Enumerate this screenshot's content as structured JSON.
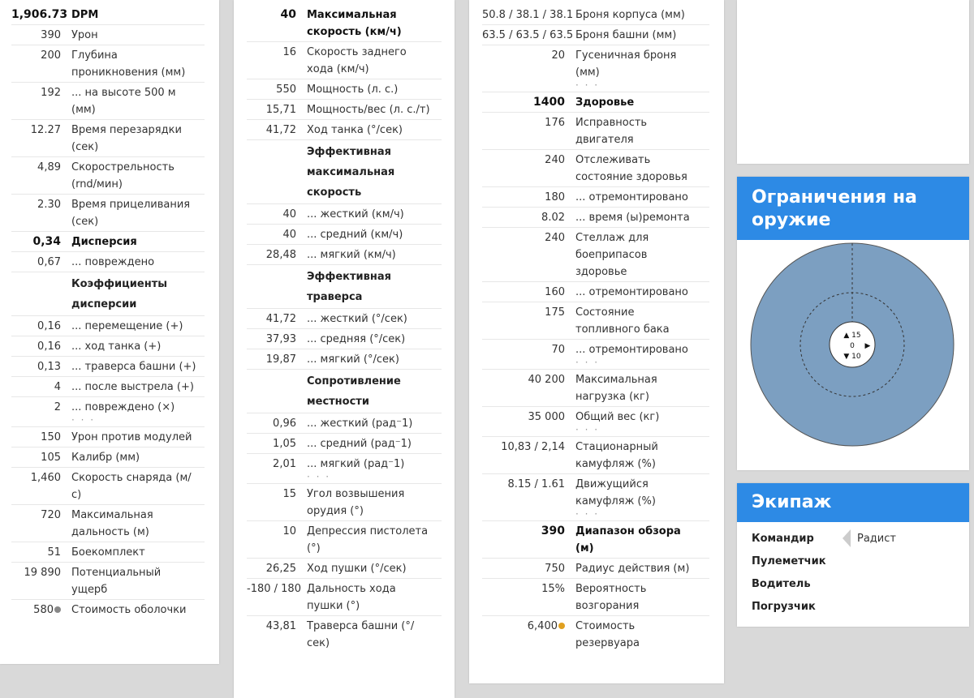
{
  "col1": [
    {
      "v": "1,906.73",
      "l": "DPM",
      "bold": true
    },
    {
      "v": "390",
      "l": "Урон"
    },
    {
      "v": "200",
      "l": "Глубина проникновения (мм)"
    },
    {
      "v": "192",
      "l": "... на высоте 500 м (мм)"
    },
    {
      "v": "12.27",
      "l": "Время перезарядки (сек)"
    },
    {
      "v": "4,89",
      "l": "Скорострельность (rnd/мин)"
    },
    {
      "v": "2.30",
      "l": "Время прицеливания (сек)"
    },
    {
      "v": "0,34",
      "l": "Дисперсия",
      "bold": true
    },
    {
      "v": "0,67",
      "l": "... повреждено"
    },
    {
      "v": "",
      "l": "Коэффициенты дисперсии",
      "heading": true
    },
    {
      "v": "0,16",
      "l": "... перемещение (+)"
    },
    {
      "v": "0,16",
      "l": "... ход танка (+)"
    },
    {
      "v": "0,13",
      "l": "... траверса башни (+)"
    },
    {
      "v": "4",
      "l": "... после выстрела (+)"
    },
    {
      "v": "2",
      "l": "... повреждено (×)",
      "dots": true
    },
    {
      "v": "150",
      "l": "Урон против модулей"
    },
    {
      "v": "105",
      "l": "Калибр (мм)"
    },
    {
      "v": "1,460",
      "l": "Скорость снаряда (м/с)"
    },
    {
      "v": "720",
      "l": "Максимальная дальность (м)"
    },
    {
      "v": "51",
      "l": "Боекомплект"
    },
    {
      "v": "19 890",
      "l": "Потенциальный ущерб"
    },
    {
      "v": "580",
      "l": "Стоимость оболочки",
      "coin": "silver"
    }
  ],
  "col2": [
    {
      "v": "40",
      "l": "Максимальная скорость (км/ч)",
      "bold": true
    },
    {
      "v": "16",
      "l": "Скорость заднего хода (км/ч)"
    },
    {
      "v": "550",
      "l": "Мощность (л. с.)"
    },
    {
      "v": "15,71",
      "l": "Мощность/вес (л. с./т)"
    },
    {
      "v": "41,72",
      "l": "Ход танка (°/сек)"
    },
    {
      "v": "",
      "l": "Эффективная максимальная скорость",
      "heading": true
    },
    {
      "v": "40",
      "l": "... жесткий (км/ч)"
    },
    {
      "v": "40",
      "l": "... средний (км/ч)"
    },
    {
      "v": "28,48",
      "l": "... мягкий (км/ч)"
    },
    {
      "v": "",
      "l": "Эффективная траверса",
      "heading": true
    },
    {
      "v": "41,72",
      "l": "... жесткий (°/сек)"
    },
    {
      "v": "37,93",
      "l": "... средняя (°/сек)"
    },
    {
      "v": "19,87",
      "l": "... мягкий (°/сек)"
    },
    {
      "v": "",
      "l": "Сопротивление местности",
      "heading": true
    },
    {
      "v": "0,96",
      "l": "... жесткий (рад⁻1)"
    },
    {
      "v": "1,05",
      "l": "... средний (рад⁻1)"
    },
    {
      "v": "2,01",
      "l": "... мягкий (рад⁻1)",
      "dots": true
    },
    {
      "v": "15",
      "l": "Угол возвышения орудия (°)"
    },
    {
      "v": "10",
      "l": "Депрессия пистолета (°)"
    },
    {
      "v": "26,25",
      "l": "Ход пушки (°/сек)"
    },
    {
      "v": "-180 / 180",
      "l": "Дальность хода пушки (°)"
    },
    {
      "v": "43,81",
      "l": "Траверса башни (°/сек)"
    }
  ],
  "col3": [
    {
      "v": "50.8 / 38.1 / 38.1",
      "l": "Броня корпуса (мм)"
    },
    {
      "v": "63.5 / 63.5 / 63.5",
      "l": "Броня башни (мм)"
    },
    {
      "v": "20",
      "l": "Гусеничная броня (мм)",
      "dots": true
    },
    {
      "v": "1400",
      "l": "Здоровье",
      "bold": true
    },
    {
      "v": "176",
      "l": "Исправность двигателя"
    },
    {
      "v": "240",
      "l": "Отслеживать состояние здоровья"
    },
    {
      "v": "180",
      "l": "... отремонтировано"
    },
    {
      "v": "8.02",
      "l": "... время (ы)ремонта"
    },
    {
      "v": "240",
      "l": "Стеллаж для боеприпасов здоровье"
    },
    {
      "v": "160",
      "l": "... отремонтировано"
    },
    {
      "v": "175",
      "l": "Состояние топливного бака"
    },
    {
      "v": "70",
      "l": "... отремонтировано",
      "dots": true
    },
    {
      "v": "40 200",
      "l": "Максимальная нагрузка (кг)"
    },
    {
      "v": "35 000",
      "l": "Общий вес (кг)",
      "dots": true
    },
    {
      "v": "10,83 / 2,14",
      "l": "Стационарный камуфляж (%)"
    },
    {
      "v": "8.15 / 1.61",
      "l": "Движущийся камуфляж (%)",
      "dots": true
    },
    {
      "v": "390",
      "l": "Диапазон обзора (м)",
      "bold": true
    },
    {
      "v": "750",
      "l": "Радиус действия (м)"
    },
    {
      "v": "15%",
      "l": "Вероятность возгорания"
    },
    {
      "v": "6,400",
      "l": "Стоимость резервуара",
      "coin": "gold"
    }
  ],
  "weapon": {
    "title": "Ограничения на оружие",
    "elev": "▲ 15",
    "center": "0",
    "dep": "▼ 10",
    "right": "▶",
    "left": "◀"
  },
  "crew": {
    "title": "Экипаж",
    "members": [
      {
        "role": "Командир",
        "sub": "Радист"
      },
      {
        "role": "Пулеметчик",
        "sub": ""
      },
      {
        "role": "Водитель",
        "sub": ""
      },
      {
        "role": "Погрузчик",
        "sub": ""
      }
    ]
  },
  "colors": {
    "accent": "#2d8ae5",
    "disk": "#7c9fc1"
  }
}
